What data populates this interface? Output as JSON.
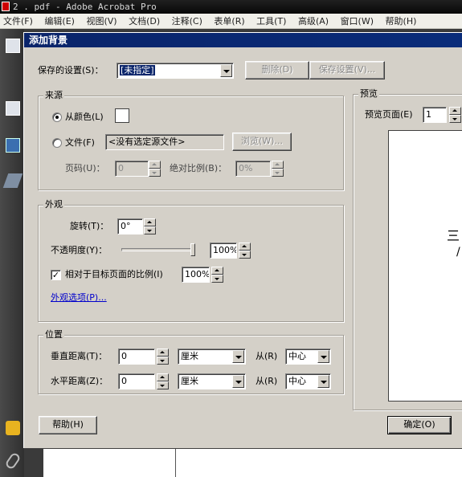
{
  "app": {
    "title": "2   . pdf - Adobe Acrobat Pro"
  },
  "menubar": {
    "items": [
      "文件(F)",
      "编辑(E)",
      "视图(V)",
      "文档(D)",
      "注释(C)",
      "表单(R)",
      "工具(T)",
      "高级(A)",
      "窗口(W)",
      "帮助(H)"
    ]
  },
  "dialog": {
    "title": "添加背景",
    "saved_settings": {
      "label": "保存的设置(S)：",
      "value": "[未指定]",
      "delete_label": "删除(D)",
      "save_label": "保存设置(V)..."
    },
    "source": {
      "group_title": "来源",
      "from_color_label": "从颜色(L)",
      "from_color_selected": true,
      "swatch_color": "#ffffff",
      "file_label": "文件(F)",
      "file_value": "<没有选定源文件>",
      "browse_label": "浏览(W)...",
      "page_number_label": "页码(U)：",
      "page_number_value": "0",
      "absolute_scale_label": "绝对比例(B)：",
      "absolute_scale_value": "0%"
    },
    "appearance": {
      "group_title": "外观",
      "rotation_label": "旋转(T)：",
      "rotation_value": "0°",
      "opacity_label": "不透明度(Y)：",
      "opacity_value": "100%",
      "opacity_fraction": 1.0,
      "relative_scale_label": "相对于目标页面的比例(I)",
      "relative_scale_checked": true,
      "relative_scale_value": "100%",
      "options_link": "外观选项(P)..."
    },
    "position": {
      "group_title": "位置",
      "vertical_label": "垂直距离(T)：",
      "vertical_value": "0",
      "vertical_unit": "厘米",
      "vertical_from_label": "从(R)",
      "vertical_from_value": "中心",
      "horizontal_label": "水平距离(Z)：",
      "horizontal_value": "0",
      "horizontal_unit": "厘米",
      "horizontal_from_label": "从(R)",
      "horizontal_from_value": "中心"
    },
    "preview": {
      "group_title": "预览",
      "page_label": "预览页面(E)",
      "page_value": "1",
      "sample_text_1": "三",
      "sample_text_2": "/"
    },
    "buttons": {
      "help": "帮助(H)",
      "ok": "确定(O)"
    }
  },
  "colors": {
    "dialog_bg": "#d4d0c8",
    "titlebar": "#0a246a",
    "link": "#0000cc"
  }
}
